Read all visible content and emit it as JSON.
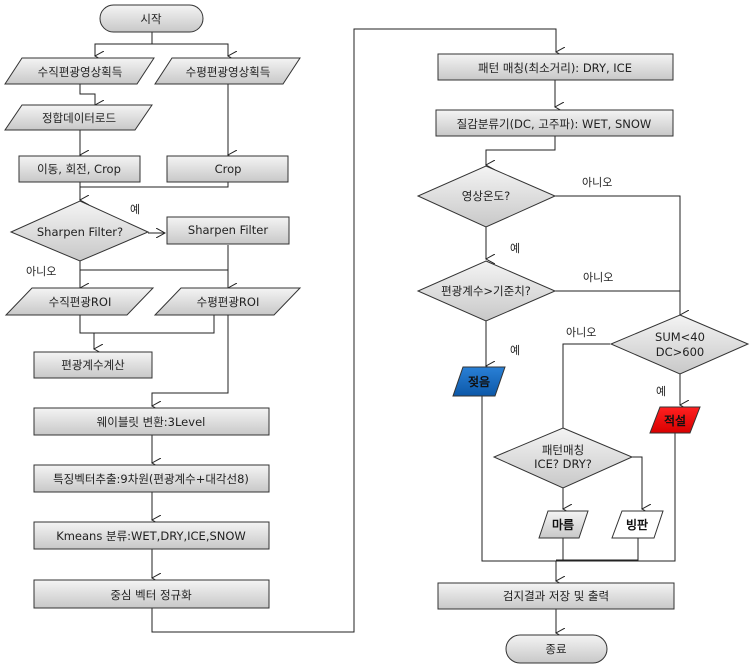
{
  "diagram": {
    "left_column": {
      "start": "시작",
      "input_vertical": "수직편광영상획득",
      "input_horizontal": "수평편광영상획득",
      "load_registration": "정합데이터로드",
      "move_rotate_crop": "이동, 회전, Crop",
      "crop": "Crop",
      "decision_sharpen": "Sharpen Filter?",
      "sharpen_filter": "Sharpen Filter",
      "roi_vertical": "수직편광ROI",
      "roi_horizontal": "수평편광ROI",
      "compute_coeff": "편광계수계산",
      "wavelet": "웨이블릿 변환:3Level",
      "feature_extract": "특징벡터추출:9차원(편광계수+대각선8)",
      "kmeans": "Kmeans 분류:WET,DRY,ICE,SNOW",
      "normalize": "중심 벡터 정규화"
    },
    "right_column": {
      "pattern_matching": "패턴 매칭(최소거리): DRY, ICE",
      "texture_classifier": "질감분류기(DC, 고주파): WET, SNOW",
      "decision_temperature": "영상온도?",
      "decision_coeff": "편광계수>기준치?",
      "decision_sum_dc_line1": "SUM<40",
      "decision_sum_dc_line2": "DC>600",
      "wet": "젖음",
      "snow": "적설",
      "decision_pattern_line1": "패턴매칭",
      "decision_pattern_line2": "ICE? DRY?",
      "dry": "마름",
      "ice": "빙판",
      "save_output": "검지결과 저장 및 출력",
      "end": "종료"
    },
    "edge_labels": {
      "yes": "예",
      "no": "아니오"
    },
    "colors": {
      "wet_fill": "#1f6fc4",
      "snow_fill": "#f01010",
      "ice_fill": "#ffffff",
      "default_fill": "#d9d9d9"
    }
  }
}
